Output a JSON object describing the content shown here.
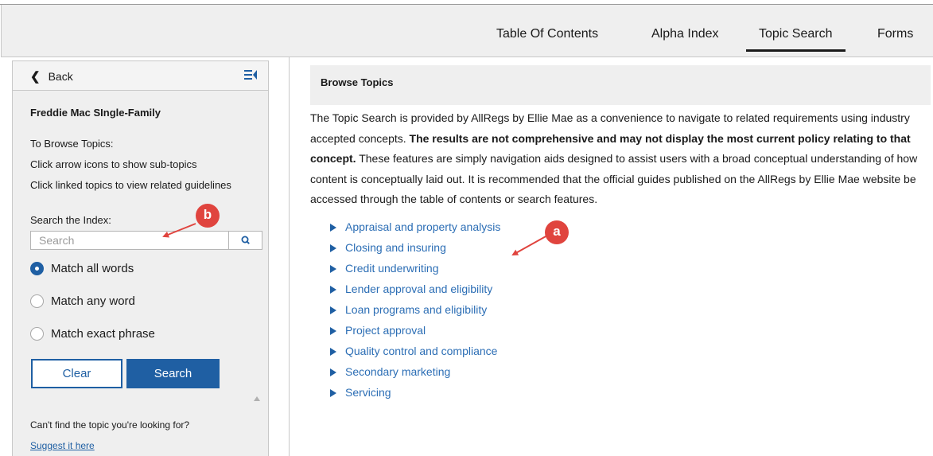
{
  "nav": {
    "tabs": [
      {
        "label": "Table Of Contents"
      },
      {
        "label": "Alpha Index"
      },
      {
        "label": "Topic Search"
      },
      {
        "label": "Forms"
      }
    ],
    "active_tab": "Topic Search"
  },
  "sidebar": {
    "back_label": "Back",
    "title": "Freddie Mac SIngle-Family",
    "instructions": [
      "To Browse Topics:",
      "Click arrow icons to show sub-topics",
      "Click linked topics to view related guidelines"
    ],
    "search_label": "Search the Index:",
    "search_placeholder": "Search",
    "search_value": "",
    "match_options": [
      {
        "label": "Match all words",
        "checked": true
      },
      {
        "label": "Match any word",
        "checked": false
      },
      {
        "label": "Match exact phrase",
        "checked": false
      }
    ],
    "clear_label": "Clear",
    "search_button_label": "Search",
    "help_text": "Can't find the topic you're looking for?",
    "suggest_link": "Suggest it here"
  },
  "main": {
    "browse_title": "Browse Topics",
    "intro_part1": "The Topic Search is provided by AllRegs by Ellie Mae as a convenience to navigate to related requirements using industry accepted concepts. ",
    "intro_bold": "The results are not comprehensive and may not display the most current policy relating to that concept.",
    "intro_part2": " These features are simply navigation aids designed to assist users with a broad conceptual understanding of how content is conceptually laid out. It is recommended that the official guides published on the AllRegs by Ellie Mae website be accessed through the table of contents or search features.",
    "topics": [
      "Appraisal and property analysis",
      "Closing and insuring",
      "Credit underwriting",
      "Lender approval and eligibility",
      "Loan programs and eligibility",
      "Project approval",
      "Quality control and compliance",
      "Secondary marketing",
      "Servicing"
    ]
  },
  "annotations": {
    "a": "a",
    "b": "b"
  },
  "colors": {
    "accent": "#1f5fa3",
    "link": "#2c6eb5",
    "callout": "#e0443e",
    "panel_bg": "#efefef"
  }
}
